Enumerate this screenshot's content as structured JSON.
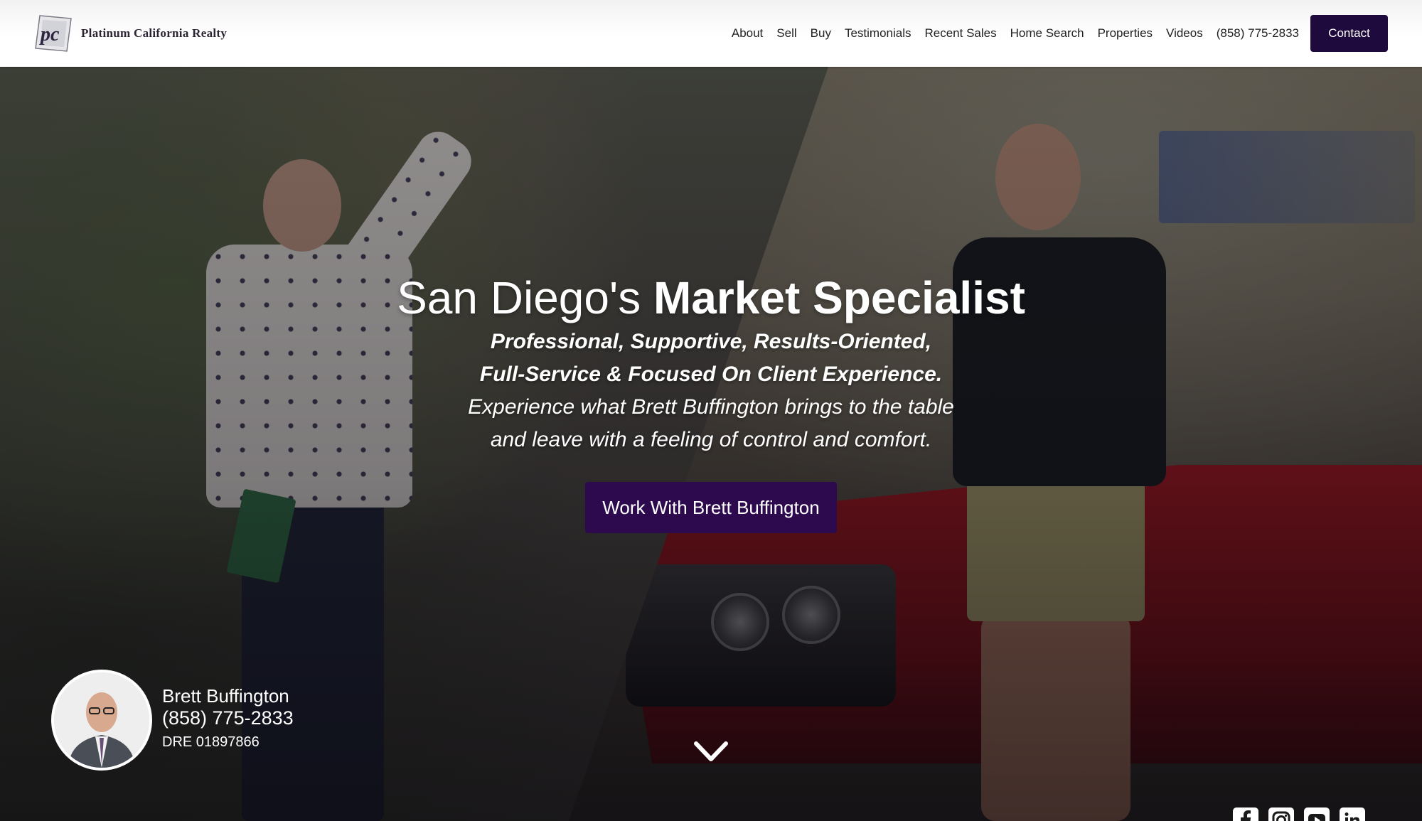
{
  "header": {
    "brand": "Platinum California Realty",
    "logo_text": "pc",
    "nav": [
      "About",
      "Sell",
      "Buy",
      "Testimonials",
      "Recent Sales",
      "Home Search",
      "Properties",
      "Videos"
    ],
    "phone": "(858) 775-2833",
    "contact_label": "Contact"
  },
  "hero": {
    "title_light": "San Diego's ",
    "title_bold": "Market Specialist",
    "subtitle_line1": "Professional, Supportive, Results-Oriented,",
    "subtitle_line2": "Full-Service & Focused On Client Experience.",
    "body_line1": "Experience what Brett Buffington brings to the table",
    "body_line2": "and leave with a feeling of control and comfort.",
    "cta_label": "Work With Brett Buffington"
  },
  "agent": {
    "name": "Brett Buffington",
    "phone": "(858) 775-2833",
    "dre": "DRE 01897866"
  },
  "social": [
    "facebook-icon",
    "instagram-icon",
    "youtube-icon",
    "linkedin-icon"
  ],
  "colors": {
    "brand_purple": "#1f0a3d",
    "cta_purple": "#2d0a4d",
    "white": "#ffffff"
  }
}
